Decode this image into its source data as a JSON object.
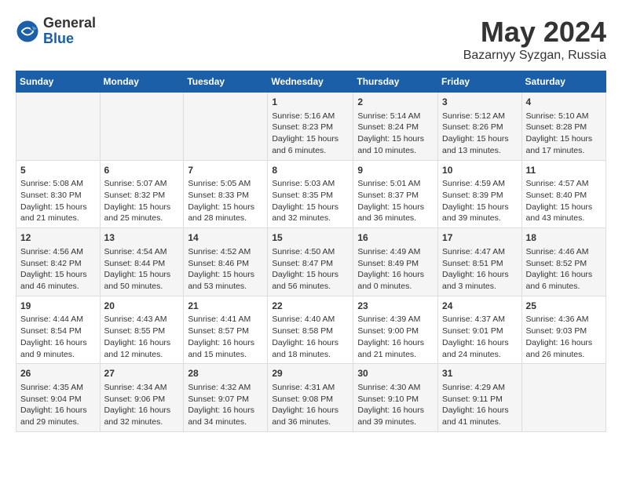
{
  "header": {
    "logo_general": "General",
    "logo_blue": "Blue",
    "month": "May 2024",
    "location": "Bazarnyy Syzgan, Russia"
  },
  "weekdays": [
    "Sunday",
    "Monday",
    "Tuesday",
    "Wednesday",
    "Thursday",
    "Friday",
    "Saturday"
  ],
  "weeks": [
    [
      {
        "day": "",
        "data": ""
      },
      {
        "day": "",
        "data": ""
      },
      {
        "day": "",
        "data": ""
      },
      {
        "day": "1",
        "data": "Sunrise: 5:16 AM\nSunset: 8:23 PM\nDaylight: 15 hours and 6 minutes."
      },
      {
        "day": "2",
        "data": "Sunrise: 5:14 AM\nSunset: 8:24 PM\nDaylight: 15 hours and 10 minutes."
      },
      {
        "day": "3",
        "data": "Sunrise: 5:12 AM\nSunset: 8:26 PM\nDaylight: 15 hours and 13 minutes."
      },
      {
        "day": "4",
        "data": "Sunrise: 5:10 AM\nSunset: 8:28 PM\nDaylight: 15 hours and 17 minutes."
      }
    ],
    [
      {
        "day": "5",
        "data": "Sunrise: 5:08 AM\nSunset: 8:30 PM\nDaylight: 15 hours and 21 minutes."
      },
      {
        "day": "6",
        "data": "Sunrise: 5:07 AM\nSunset: 8:32 PM\nDaylight: 15 hours and 25 minutes."
      },
      {
        "day": "7",
        "data": "Sunrise: 5:05 AM\nSunset: 8:33 PM\nDaylight: 15 hours and 28 minutes."
      },
      {
        "day": "8",
        "data": "Sunrise: 5:03 AM\nSunset: 8:35 PM\nDaylight: 15 hours and 32 minutes."
      },
      {
        "day": "9",
        "data": "Sunrise: 5:01 AM\nSunset: 8:37 PM\nDaylight: 15 hours and 36 minutes."
      },
      {
        "day": "10",
        "data": "Sunrise: 4:59 AM\nSunset: 8:39 PM\nDaylight: 15 hours and 39 minutes."
      },
      {
        "day": "11",
        "data": "Sunrise: 4:57 AM\nSunset: 8:40 PM\nDaylight: 15 hours and 43 minutes."
      }
    ],
    [
      {
        "day": "12",
        "data": "Sunrise: 4:56 AM\nSunset: 8:42 PM\nDaylight: 15 hours and 46 minutes."
      },
      {
        "day": "13",
        "data": "Sunrise: 4:54 AM\nSunset: 8:44 PM\nDaylight: 15 hours and 50 minutes."
      },
      {
        "day": "14",
        "data": "Sunrise: 4:52 AM\nSunset: 8:46 PM\nDaylight: 15 hours and 53 minutes."
      },
      {
        "day": "15",
        "data": "Sunrise: 4:50 AM\nSunset: 8:47 PM\nDaylight: 15 hours and 56 minutes."
      },
      {
        "day": "16",
        "data": "Sunrise: 4:49 AM\nSunset: 8:49 PM\nDaylight: 16 hours and 0 minutes."
      },
      {
        "day": "17",
        "data": "Sunrise: 4:47 AM\nSunset: 8:51 PM\nDaylight: 16 hours and 3 minutes."
      },
      {
        "day": "18",
        "data": "Sunrise: 4:46 AM\nSunset: 8:52 PM\nDaylight: 16 hours and 6 minutes."
      }
    ],
    [
      {
        "day": "19",
        "data": "Sunrise: 4:44 AM\nSunset: 8:54 PM\nDaylight: 16 hours and 9 minutes."
      },
      {
        "day": "20",
        "data": "Sunrise: 4:43 AM\nSunset: 8:55 PM\nDaylight: 16 hours and 12 minutes."
      },
      {
        "day": "21",
        "data": "Sunrise: 4:41 AM\nSunset: 8:57 PM\nDaylight: 16 hours and 15 minutes."
      },
      {
        "day": "22",
        "data": "Sunrise: 4:40 AM\nSunset: 8:58 PM\nDaylight: 16 hours and 18 minutes."
      },
      {
        "day": "23",
        "data": "Sunrise: 4:39 AM\nSunset: 9:00 PM\nDaylight: 16 hours and 21 minutes."
      },
      {
        "day": "24",
        "data": "Sunrise: 4:37 AM\nSunset: 9:01 PM\nDaylight: 16 hours and 24 minutes."
      },
      {
        "day": "25",
        "data": "Sunrise: 4:36 AM\nSunset: 9:03 PM\nDaylight: 16 hours and 26 minutes."
      }
    ],
    [
      {
        "day": "26",
        "data": "Sunrise: 4:35 AM\nSunset: 9:04 PM\nDaylight: 16 hours and 29 minutes."
      },
      {
        "day": "27",
        "data": "Sunrise: 4:34 AM\nSunset: 9:06 PM\nDaylight: 16 hours and 32 minutes."
      },
      {
        "day": "28",
        "data": "Sunrise: 4:32 AM\nSunset: 9:07 PM\nDaylight: 16 hours and 34 minutes."
      },
      {
        "day": "29",
        "data": "Sunrise: 4:31 AM\nSunset: 9:08 PM\nDaylight: 16 hours and 36 minutes."
      },
      {
        "day": "30",
        "data": "Sunrise: 4:30 AM\nSunset: 9:10 PM\nDaylight: 16 hours and 39 minutes."
      },
      {
        "day": "31",
        "data": "Sunrise: 4:29 AM\nSunset: 9:11 PM\nDaylight: 16 hours and 41 minutes."
      },
      {
        "day": "",
        "data": ""
      }
    ]
  ]
}
